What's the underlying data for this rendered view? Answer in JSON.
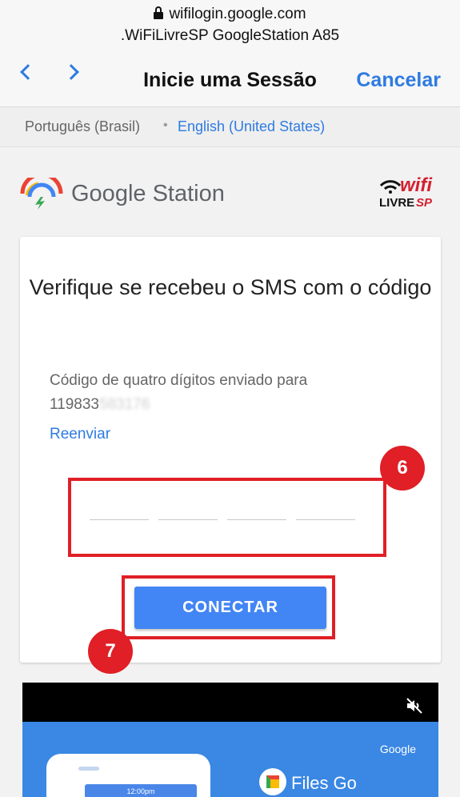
{
  "browser": {
    "url": "wifilogin.google.com",
    "page_subtitle": ".WiFiLivreSP GoogleStation A85",
    "nav_title": "Inicie uma Sessão",
    "cancel_label": "Cancelar"
  },
  "languages": {
    "current": "Português (Brasil)",
    "separator": "•",
    "alternate": "English (United States)"
  },
  "brand": {
    "google_station": "Google Station",
    "wifi_word": "wifi",
    "livre_word": "LIVRE",
    "sp_word": "SP"
  },
  "card": {
    "title": "Verifique se recebeu o SMS com o código",
    "description": "Código de quatro dígitos enviado para",
    "phone_visible": "119833",
    "phone_blurred": "583176",
    "resend_label": "Reenviar",
    "code_digits": [
      "",
      "",
      "",
      ""
    ],
    "connect_label": "CONECTAR"
  },
  "annotations": {
    "step_6": "6",
    "step_7": "7",
    "color": "#e01f26"
  },
  "ad": {
    "google_label": "Google",
    "files_label": "Files Go",
    "phone_bar_text": "12:00pm"
  },
  "colors": {
    "accent": "#2e7be0",
    "button": "#4285f4"
  }
}
